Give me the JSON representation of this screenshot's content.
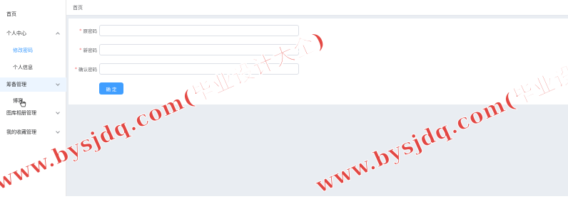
{
  "sidebar": {
    "items": [
      {
        "label": "首页"
      },
      {
        "label": "个人中心"
      },
      {
        "label": "修改密码"
      },
      {
        "label": "个人信息"
      },
      {
        "label": "筹备管理"
      },
      {
        "label": "博客"
      },
      {
        "label": "图库相册管理"
      },
      {
        "label": "我的收藏管理"
      }
    ]
  },
  "breadcrumb": {
    "current": "首页"
  },
  "form": {
    "fields": [
      {
        "label": "原密码",
        "value": "",
        "placeholder": ""
      },
      {
        "label": "新密码",
        "value": "",
        "placeholder": ""
      },
      {
        "label": "确认密码",
        "value": "",
        "placeholder": ""
      }
    ],
    "submit_label": "确 定"
  },
  "watermarks": [
    "www.bysjdq.com(毕业设计大全)",
    "www.bysjdq.com(毕业设计大全)"
  ],
  "colors": {
    "accent": "#409eff",
    "required": "#f56c6c",
    "watermark": "#e23a35",
    "content_bg": "#e9edf2"
  }
}
